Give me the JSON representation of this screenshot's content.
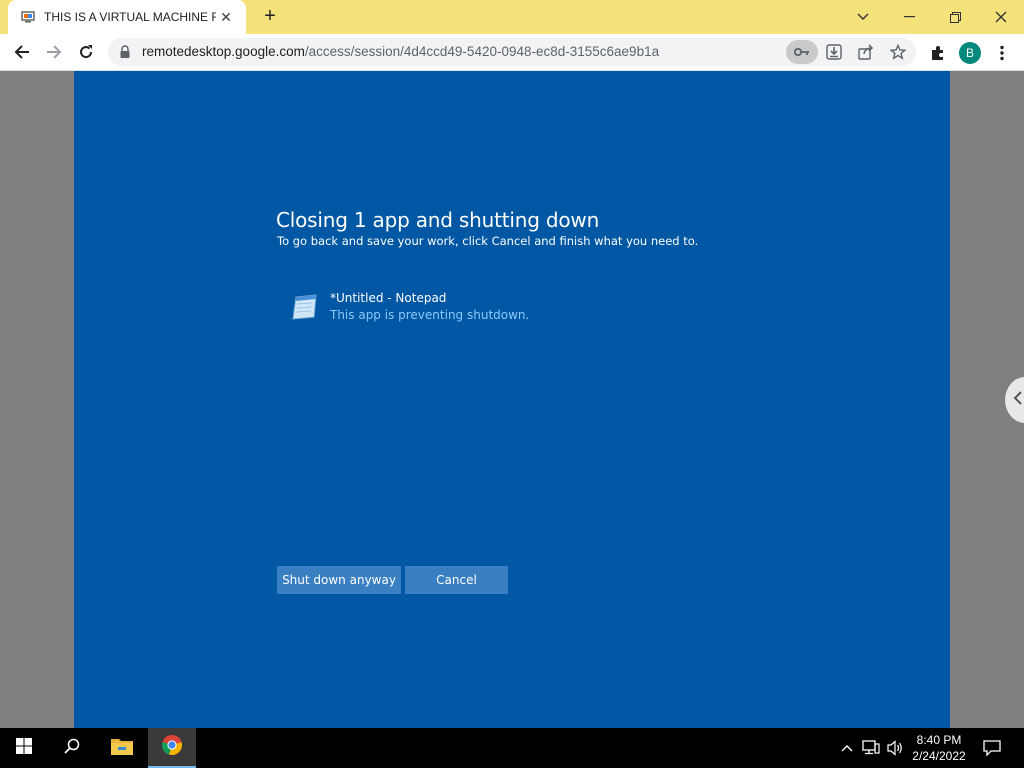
{
  "browser": {
    "tab_title": "THIS IS A VIRTUAL MACHINE FUC",
    "url_host": "remotedesktop.google.com",
    "url_path": "/access/session/4d4ccd49-5420-0948-ec8d-3155c6ae9b1a",
    "profile_initial": "B",
    "accent_color": "#f6e27a",
    "profile_color": "#00897b"
  },
  "dialog": {
    "title": "Closing 1 app and shutting down",
    "subtitle": "To go back and save your work, click Cancel and finish what you need to.",
    "app_name": "*Untitled - Notepad",
    "app_status": "This app is preventing shutdown.",
    "shutdown_button": "Shut down anyway",
    "cancel_button": "Cancel",
    "background_color": "#0057a3"
  },
  "taskbar": {
    "time": "8:40 PM",
    "date": "2/24/2022"
  }
}
